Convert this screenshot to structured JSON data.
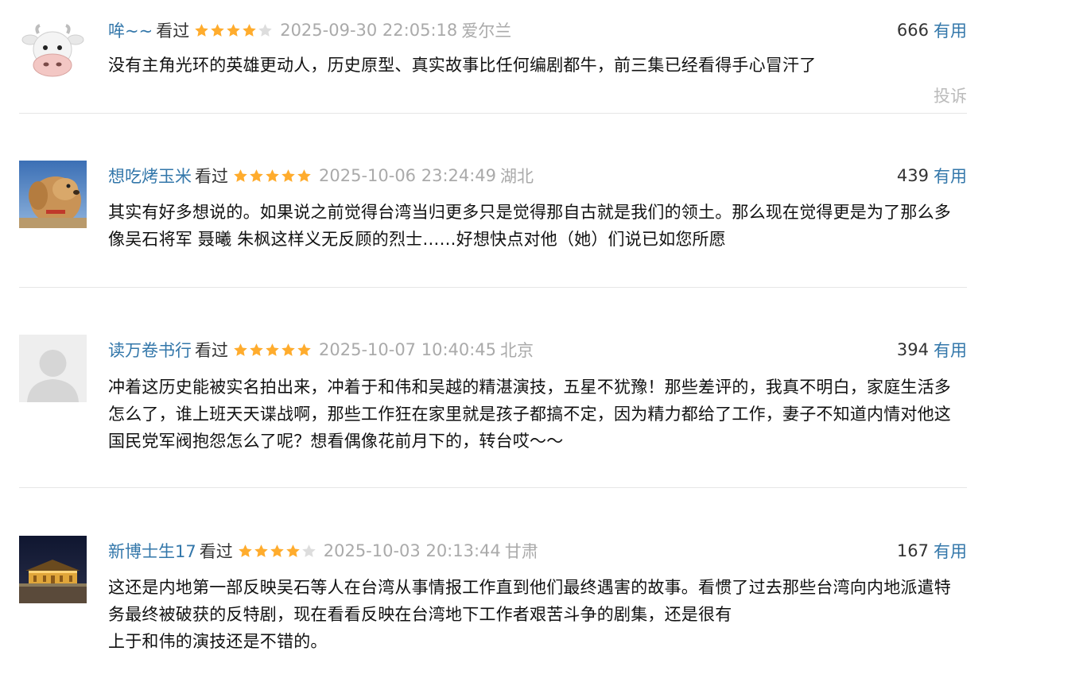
{
  "reviews": [
    {
      "username": "哞~~",
      "status": "看过",
      "rating": 4,
      "rating_max": 5,
      "time": "2025-09-30 22:05:18",
      "location": "爱尔兰",
      "votes": "666",
      "useful_label": "有用",
      "content": "没有主角光环的英雄更动人，历史原型、真实故事比任何编剧都牛，前三集已经看得手心冒汗了",
      "report_label": "投诉",
      "avatar_icon": "cow-emoji-avatar"
    },
    {
      "username": "想吃烤玉米",
      "status": "看过",
      "rating": 5,
      "rating_max": 5,
      "time": "2025-10-06 23:24:49",
      "location": "湖北",
      "votes": "439",
      "useful_label": "有用",
      "content": "其实有好多想说的。如果说之前觉得台湾当归更多只是觉得那自古就是我们的领土。那么现在觉得更是为了那么多像吴石将军 聂曦 朱枫这样义无反顾的烈士……好想快点对他（她）们说已如您所愿",
      "avatar_icon": "dog-photo-avatar"
    },
    {
      "username": "读万卷书行",
      "status": "看过",
      "rating": 5,
      "rating_max": 5,
      "time": "2025-10-07 10:40:45",
      "location": "北京",
      "votes": "394",
      "useful_label": "有用",
      "content": "冲着这历史能被实名拍出来，冲着于和伟和吴越的精湛演技，五星不犹豫！那些差评的，我真不明白，家庭生活多怎么了，谁上班天天谍战啊，那些工作狂在家里就是孩子都搞不定，因为精力都给了工作，妻子不知道内情对他这国民党军阀抱怨怎么了呢？想看偶像花前月下的，转台哎～～",
      "avatar_icon": "default-user-avatar"
    },
    {
      "username": "新博士生17",
      "status": "看过",
      "rating": 4,
      "rating_max": 5,
      "time": "2025-10-03 20:13:44",
      "location": "甘肃",
      "votes": "167",
      "useful_label": "有用",
      "content": "这还是内地第一部反映吴石等人在台湾从事情报工作直到他们最终遇害的故事。看惯了过去那些台湾向内地派遣特务最终被破获的反特剧，现在看看反映在台湾地下工作者艰苦斗争的剧集，还是很有",
      "content_tail": "上于和伟的演技还是不错的。",
      "avatar_icon": "night-palace-photo-avatar"
    }
  ],
  "colors": {
    "link": "#3377aa",
    "star": "#ffac2d",
    "star_empty": "#dddddd",
    "meta_gray": "#aaaaaa"
  }
}
